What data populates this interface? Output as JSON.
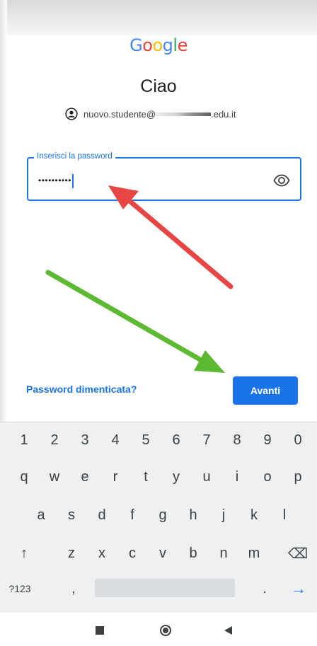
{
  "logo": {
    "letters": [
      "G",
      "o",
      "o",
      "g",
      "l",
      "e"
    ],
    "colors": [
      "#4285F4",
      "#EA4335",
      "#FBBC05",
      "#4285F4",
      "#34A853",
      "#EA4335"
    ]
  },
  "greeting": "Ciao",
  "account": {
    "email_prefix": "nuovo.studente@",
    "email_suffix": ".edu.it",
    "icon": "account-circle-icon"
  },
  "password": {
    "label": "Inserisci la password",
    "masked_value": "••••••••••",
    "toggle_icon": "eye-icon"
  },
  "actions": {
    "forgot": "Password dimenticata?",
    "next": "Avanti"
  },
  "annotations": {
    "red_arrow_color": "#E84545",
    "green_arrow_color": "#5DB832"
  },
  "keyboard": {
    "rows": [
      [
        "1",
        "2",
        "3",
        "4",
        "5",
        "6",
        "7",
        "8",
        "9",
        "0"
      ],
      [
        "q",
        "w",
        "e",
        "r",
        "t",
        "y",
        "u",
        "i",
        "o",
        "p"
      ],
      [
        "a",
        "s",
        "d",
        "f",
        "g",
        "h",
        "j",
        "k",
        "l"
      ],
      [
        "↑",
        "z",
        "x",
        "c",
        "v",
        "b",
        "n",
        "m",
        "⌫"
      ]
    ],
    "symbols_key": "?123",
    "comma_key": ",",
    "period_key": ".",
    "enter_key": "→"
  },
  "nav": {
    "recent": "square-icon",
    "home": "circle-icon",
    "back": "triangle-back-icon"
  }
}
